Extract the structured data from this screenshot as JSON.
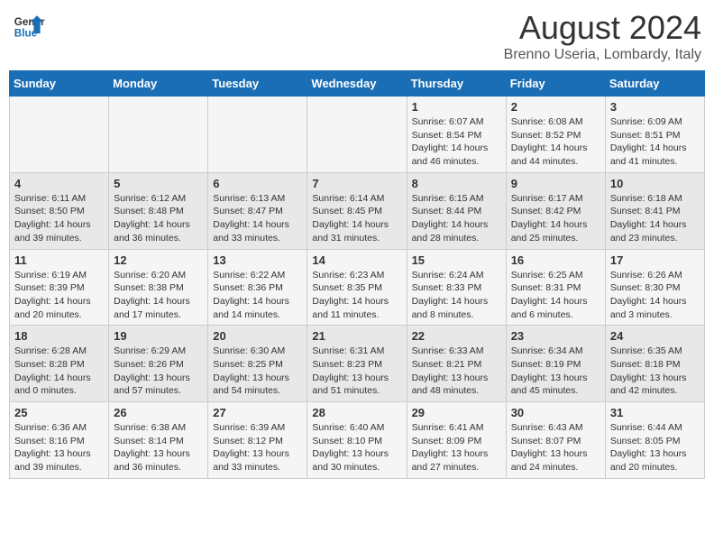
{
  "header": {
    "logo_line1": "General",
    "logo_line2": "Blue",
    "title": "August 2024",
    "subtitle": "Brenno Useria, Lombardy, Italy"
  },
  "calendar": {
    "headers": [
      "Sunday",
      "Monday",
      "Tuesday",
      "Wednesday",
      "Thursday",
      "Friday",
      "Saturday"
    ],
    "weeks": [
      [
        {
          "day": "",
          "info": ""
        },
        {
          "day": "",
          "info": ""
        },
        {
          "day": "",
          "info": ""
        },
        {
          "day": "",
          "info": ""
        },
        {
          "day": "1",
          "info": "Sunrise: 6:07 AM\nSunset: 8:54 PM\nDaylight: 14 hours and 46 minutes."
        },
        {
          "day": "2",
          "info": "Sunrise: 6:08 AM\nSunset: 8:52 PM\nDaylight: 14 hours and 44 minutes."
        },
        {
          "day": "3",
          "info": "Sunrise: 6:09 AM\nSunset: 8:51 PM\nDaylight: 14 hours and 41 minutes."
        }
      ],
      [
        {
          "day": "4",
          "info": "Sunrise: 6:11 AM\nSunset: 8:50 PM\nDaylight: 14 hours and 39 minutes."
        },
        {
          "day": "5",
          "info": "Sunrise: 6:12 AM\nSunset: 8:48 PM\nDaylight: 14 hours and 36 minutes."
        },
        {
          "day": "6",
          "info": "Sunrise: 6:13 AM\nSunset: 8:47 PM\nDaylight: 14 hours and 33 minutes."
        },
        {
          "day": "7",
          "info": "Sunrise: 6:14 AM\nSunset: 8:45 PM\nDaylight: 14 hours and 31 minutes."
        },
        {
          "day": "8",
          "info": "Sunrise: 6:15 AM\nSunset: 8:44 PM\nDaylight: 14 hours and 28 minutes."
        },
        {
          "day": "9",
          "info": "Sunrise: 6:17 AM\nSunset: 8:42 PM\nDaylight: 14 hours and 25 minutes."
        },
        {
          "day": "10",
          "info": "Sunrise: 6:18 AM\nSunset: 8:41 PM\nDaylight: 14 hours and 23 minutes."
        }
      ],
      [
        {
          "day": "11",
          "info": "Sunrise: 6:19 AM\nSunset: 8:39 PM\nDaylight: 14 hours and 20 minutes."
        },
        {
          "day": "12",
          "info": "Sunrise: 6:20 AM\nSunset: 8:38 PM\nDaylight: 14 hours and 17 minutes."
        },
        {
          "day": "13",
          "info": "Sunrise: 6:22 AM\nSunset: 8:36 PM\nDaylight: 14 hours and 14 minutes."
        },
        {
          "day": "14",
          "info": "Sunrise: 6:23 AM\nSunset: 8:35 PM\nDaylight: 14 hours and 11 minutes."
        },
        {
          "day": "15",
          "info": "Sunrise: 6:24 AM\nSunset: 8:33 PM\nDaylight: 14 hours and 8 minutes."
        },
        {
          "day": "16",
          "info": "Sunrise: 6:25 AM\nSunset: 8:31 PM\nDaylight: 14 hours and 6 minutes."
        },
        {
          "day": "17",
          "info": "Sunrise: 6:26 AM\nSunset: 8:30 PM\nDaylight: 14 hours and 3 minutes."
        }
      ],
      [
        {
          "day": "18",
          "info": "Sunrise: 6:28 AM\nSunset: 8:28 PM\nDaylight: 14 hours and 0 minutes."
        },
        {
          "day": "19",
          "info": "Sunrise: 6:29 AM\nSunset: 8:26 PM\nDaylight: 13 hours and 57 minutes."
        },
        {
          "day": "20",
          "info": "Sunrise: 6:30 AM\nSunset: 8:25 PM\nDaylight: 13 hours and 54 minutes."
        },
        {
          "day": "21",
          "info": "Sunrise: 6:31 AM\nSunset: 8:23 PM\nDaylight: 13 hours and 51 minutes."
        },
        {
          "day": "22",
          "info": "Sunrise: 6:33 AM\nSunset: 8:21 PM\nDaylight: 13 hours and 48 minutes."
        },
        {
          "day": "23",
          "info": "Sunrise: 6:34 AM\nSunset: 8:19 PM\nDaylight: 13 hours and 45 minutes."
        },
        {
          "day": "24",
          "info": "Sunrise: 6:35 AM\nSunset: 8:18 PM\nDaylight: 13 hours and 42 minutes."
        }
      ],
      [
        {
          "day": "25",
          "info": "Sunrise: 6:36 AM\nSunset: 8:16 PM\nDaylight: 13 hours and 39 minutes."
        },
        {
          "day": "26",
          "info": "Sunrise: 6:38 AM\nSunset: 8:14 PM\nDaylight: 13 hours and 36 minutes."
        },
        {
          "day": "27",
          "info": "Sunrise: 6:39 AM\nSunset: 8:12 PM\nDaylight: 13 hours and 33 minutes."
        },
        {
          "day": "28",
          "info": "Sunrise: 6:40 AM\nSunset: 8:10 PM\nDaylight: 13 hours and 30 minutes."
        },
        {
          "day": "29",
          "info": "Sunrise: 6:41 AM\nSunset: 8:09 PM\nDaylight: 13 hours and 27 minutes."
        },
        {
          "day": "30",
          "info": "Sunrise: 6:43 AM\nSunset: 8:07 PM\nDaylight: 13 hours and 24 minutes."
        },
        {
          "day": "31",
          "info": "Sunrise: 6:44 AM\nSunset: 8:05 PM\nDaylight: 13 hours and 20 minutes."
        }
      ]
    ]
  }
}
